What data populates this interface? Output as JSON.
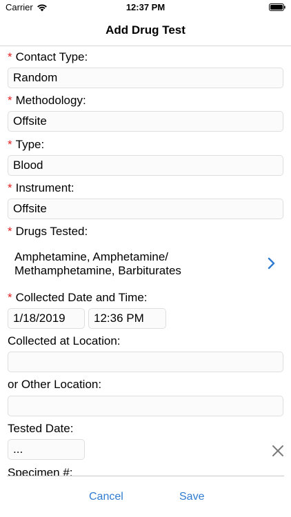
{
  "status_bar": {
    "carrier": "Carrier",
    "time": "12:37 PM"
  },
  "nav": {
    "title": "Add Drug Test"
  },
  "form": {
    "required_marker": "*",
    "contact_type": {
      "label": "Contact Type:",
      "value": "Random"
    },
    "methodology": {
      "label": "Methodology:",
      "value": "Offsite"
    },
    "type": {
      "label": "Type:",
      "value": "Blood"
    },
    "instrument": {
      "label": "Instrument:",
      "value": "Offsite"
    },
    "drugs_tested": {
      "label": "Drugs Tested:",
      "value": "Amphetamine, Amphetamine/ Methamphetamine, Barbiturates"
    },
    "collected_datetime": {
      "label": "Collected Date and Time:",
      "date": "1/18/2019",
      "time": "12:36 PM"
    },
    "collected_location": {
      "label": "Collected at Location:",
      "value": ""
    },
    "other_location": {
      "label": "or Other Location:",
      "value": ""
    },
    "tested_date": {
      "label": "Tested Date:",
      "value": "..."
    },
    "specimen": {
      "label": "Specimen #:"
    }
  },
  "toolbar": {
    "cancel_label": "Cancel",
    "save_label": "Save"
  },
  "colors": {
    "required": "#e02020",
    "accent": "#2f7bd0",
    "field_border": "#dedede"
  },
  "icons": {
    "wifi": "wifi-icon",
    "battery": "battery-icon",
    "chevron": "chevron-right-icon",
    "clear": "close-icon"
  }
}
